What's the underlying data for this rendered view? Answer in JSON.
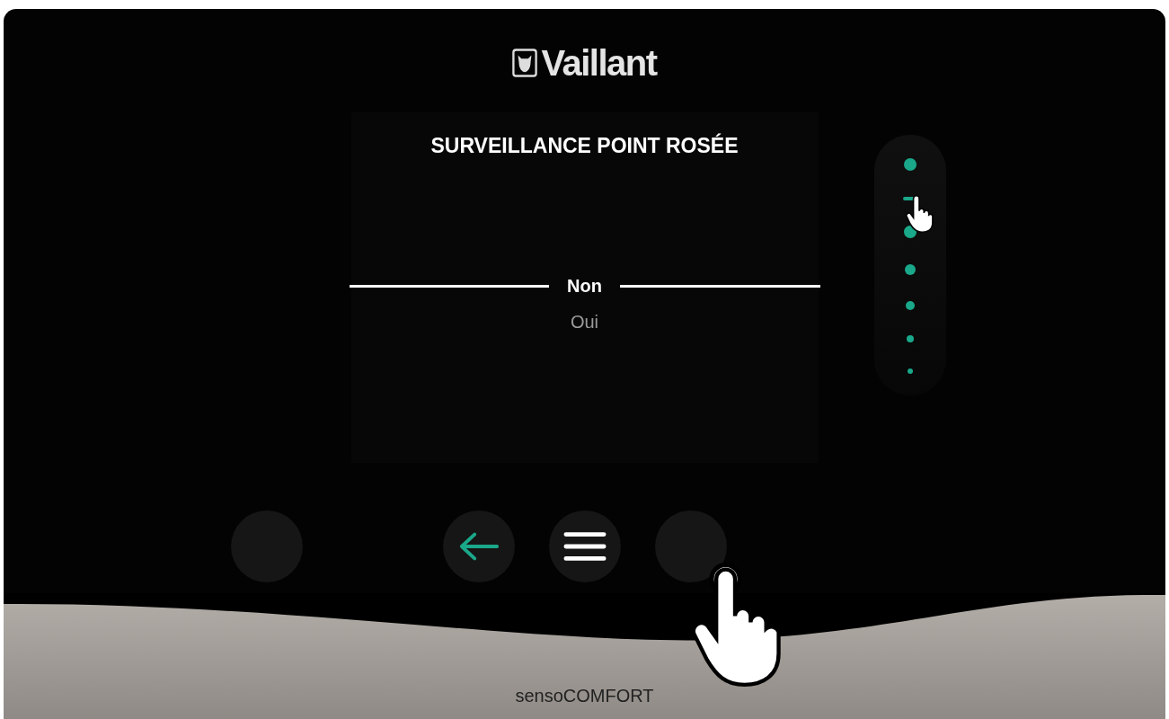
{
  "header": {
    "brand": "Vaillant"
  },
  "screen": {
    "title": "SURVEILLANCE POINT ROSÉE",
    "options": [
      {
        "label": "Non",
        "selected": true
      },
      {
        "label": "Oui",
        "selected": false
      }
    ]
  },
  "scroll_indicator": {
    "steps": [
      {
        "selected": false
      },
      {
        "selected": true
      },
      {
        "selected": false
      },
      {
        "selected": false
      },
      {
        "selected": false
      },
      {
        "selected": false
      },
      {
        "selected": false
      }
    ]
  },
  "buttons": [
    {
      "kind": "blank"
    },
    {
      "kind": "back"
    },
    {
      "kind": "menu"
    },
    {
      "kind": "blank"
    }
  ],
  "footer": {
    "model": "sensoCOMFORT"
  }
}
